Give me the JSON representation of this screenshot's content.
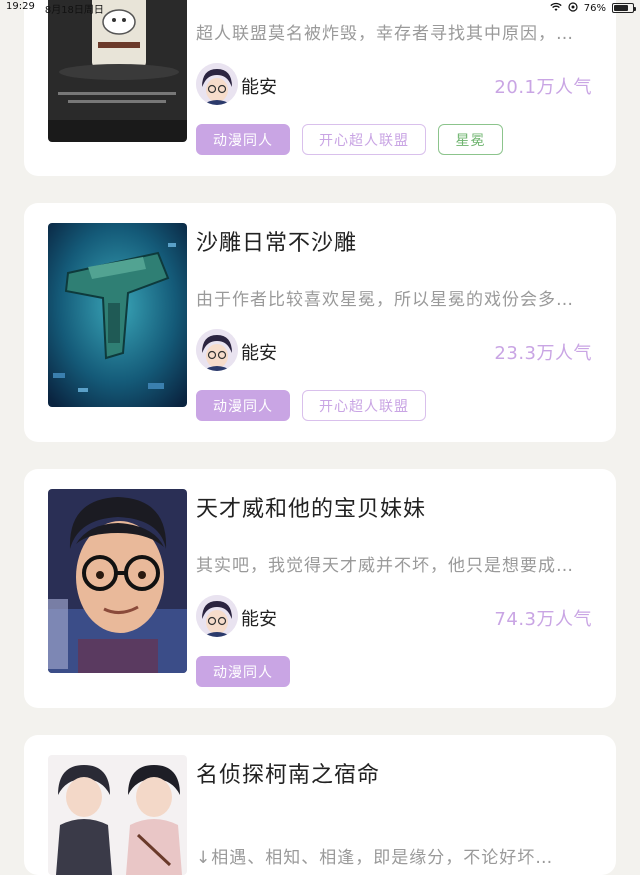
{
  "status_bar": {
    "time": "19:29",
    "date": "8月18日周日",
    "battery": "76%",
    "battery_level": 0.76
  },
  "cards": [
    {
      "title": "",
      "description": "超人联盟莫名被炸毁，幸存者寻找其中原因，…",
      "author": "能安",
      "popularity": "20.1万人气",
      "tags": [
        {
          "label": "动漫同人",
          "style": "primary"
        },
        {
          "label": "开心超人联盟",
          "style": "outline"
        },
        {
          "label": "星冕",
          "style": "green"
        }
      ],
      "cover_icon": "can-drink-cover"
    },
    {
      "title": "沙雕日常不沙雕",
      "description": "由于作者比较喜欢星冕，所以星冕的戏份会多…",
      "author": "能安",
      "popularity": "23.3万人气",
      "tags": [
        {
          "label": "动漫同人",
          "style": "primary"
        },
        {
          "label": "开心超人联盟",
          "style": "outline"
        }
      ],
      "cover_icon": "spaceship-cover"
    },
    {
      "title": "天才威和他的宝贝妹妹",
      "description": "其实吧，我觉得天才威并不坏，他只是想要成…",
      "author": "能安",
      "popularity": "74.3万人气",
      "tags": [
        {
          "label": "动漫同人",
          "style": "primary"
        }
      ],
      "cover_icon": "glasses-boy-cover"
    },
    {
      "title": "名侦探柯南之宿命",
      "description": "↓相遇、相知、相逢，即是缘分，不论好坏…",
      "author": "",
      "popularity": "",
      "tags": [],
      "cover_icon": "anime-characters-cover"
    }
  ]
}
